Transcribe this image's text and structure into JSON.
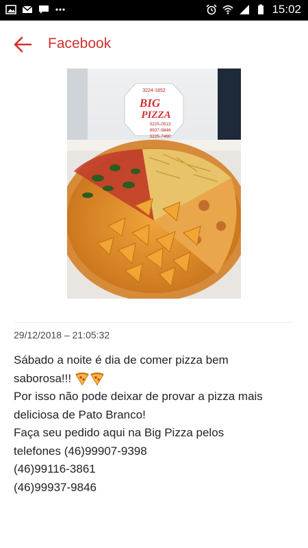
{
  "status_bar": {
    "time": "15:02",
    "left_icons": [
      "image-icon",
      "mail-icon",
      "chat-icon",
      "more-dots-icon"
    ],
    "right_icons": [
      "alarm-icon",
      "wifi-icon",
      "signal-icon",
      "battery-icon"
    ]
  },
  "header": {
    "title": "Facebook",
    "accent_color": "#d32f2f"
  },
  "photo": {
    "box_lines": [
      "3224-1852",
      "BIG",
      "PIZZA",
      "3225-0513",
      "9937-9846",
      "3225-7490"
    ]
  },
  "post": {
    "timestamp": "29/12/2018 – 21:05:32",
    "lines": [
      "Sábado a noite é dia de comer pizza bem",
      "saborosa!!!",
      "Por isso não pode deixar de provar a pizza mais",
      "deliciosa de Pato Branco!",
      "Faça seu pedido aqui na Big Pizza pelos",
      "telefones (46)99907-9398",
      "(46)99116-3861",
      "(46)99937-9846"
    ]
  }
}
